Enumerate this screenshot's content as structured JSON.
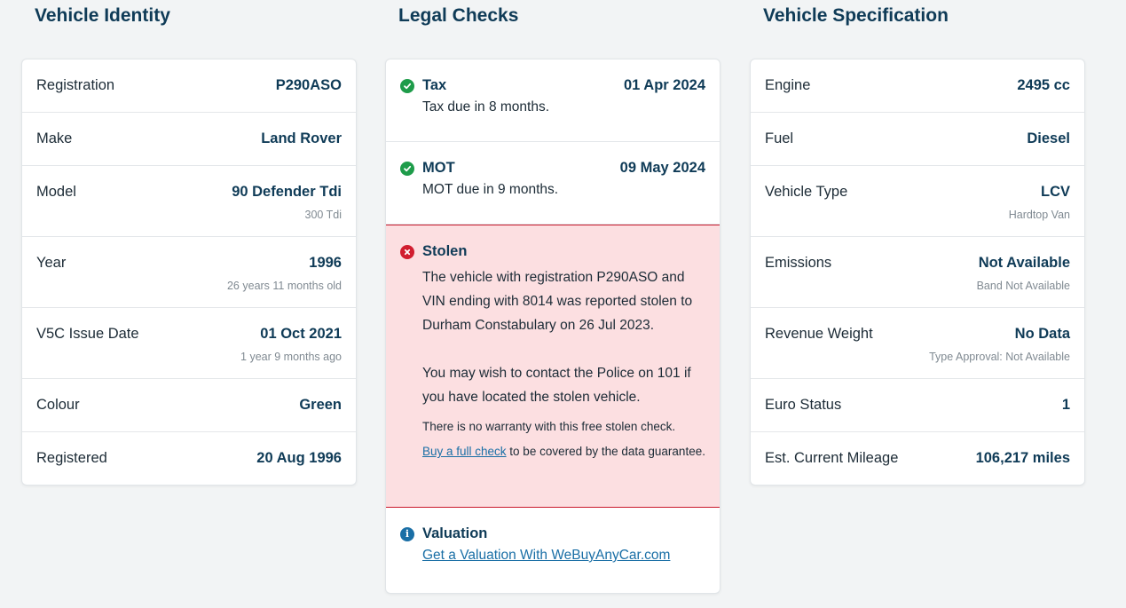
{
  "identity": {
    "title": "Vehicle Identity",
    "rows": [
      {
        "label": "Registration",
        "value": "P290ASO",
        "sub": ""
      },
      {
        "label": "Make",
        "value": "Land Rover",
        "sub": ""
      },
      {
        "label": "Model",
        "value": "90 Defender Tdi",
        "sub": "300 Tdi"
      },
      {
        "label": "Year",
        "value": "1996",
        "sub": "26 years 11 months old"
      },
      {
        "label": "V5C Issue Date",
        "value": "01 Oct 2021",
        "sub": "1 year 9 months ago"
      },
      {
        "label": "Colour",
        "value": "Green",
        "sub": ""
      },
      {
        "label": "Registered",
        "value": "20 Aug 1996",
        "sub": ""
      }
    ]
  },
  "legal": {
    "title": "Legal Checks",
    "tax": {
      "label": "Tax",
      "date": "01 Apr 2024",
      "text": "Tax due in 8 months.",
      "icon": "check-icon"
    },
    "mot": {
      "label": "MOT",
      "date": "09 May 2024",
      "text": "MOT due in 9 months.",
      "icon": "check-icon"
    },
    "stolen": {
      "label": "Stolen",
      "icon": "cross-icon",
      "para1": "The vehicle with registration P290ASO and VIN ending with 8014 was reported stolen to Durham Constabulary on 26 Jul 2023.",
      "para2": "You may wish to contact the Police on 101 if you have located the stolen vehicle.",
      "warranty": "There is no warranty with this free stolen check.",
      "link": "Buy a full check",
      "link_suffix": " to be covered by the data guarantee."
    },
    "valuation": {
      "label": "Valuation",
      "link": "Get a Valuation With WeBuyAnyCar.com",
      "icon": "info-icon"
    }
  },
  "spec": {
    "title": "Vehicle Specification",
    "rows": [
      {
        "label": "Engine",
        "value": "2495 cc",
        "sub": ""
      },
      {
        "label": "Fuel",
        "value": "Diesel",
        "sub": ""
      },
      {
        "label": "Vehicle Type",
        "value": "LCV",
        "sub": "Hardtop Van"
      },
      {
        "label": "Emissions",
        "value": "Not Available",
        "sub": "Band Not Available"
      },
      {
        "label": "Revenue Weight",
        "value": "No Data",
        "sub": "Type Approval: Not Available"
      },
      {
        "label": "Euro Status",
        "value": "1",
        "sub": ""
      },
      {
        "label": "Est. Current Mileage",
        "value": "106,217 miles",
        "sub": ""
      }
    ]
  },
  "colors": {
    "accent": "#0f3b57",
    "ok": "#1e9c4a",
    "alert": "#d11d2f",
    "alert_bg": "#fcdfe1",
    "link": "#1a6fa6"
  }
}
